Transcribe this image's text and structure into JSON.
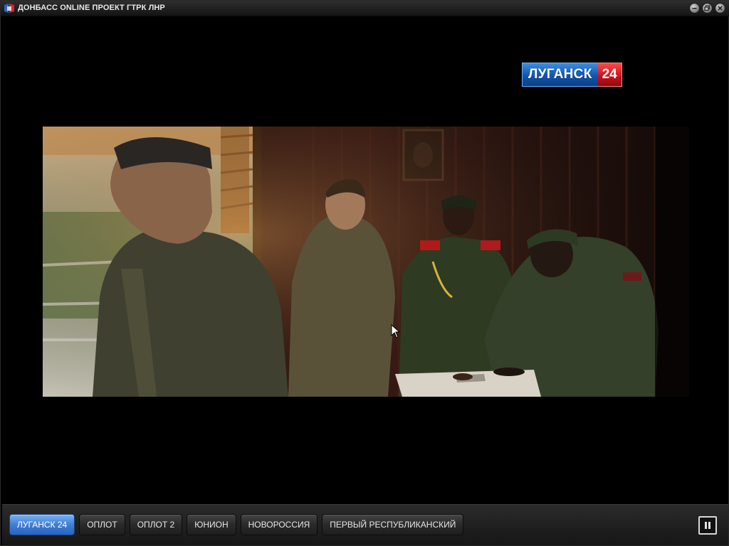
{
  "window": {
    "title": "ДОНБАСС ONLINE ПРОЕКТ ГТРК ЛНР",
    "icon": "app-logo-icon",
    "controls": [
      "minimize-icon",
      "restore-icon",
      "close-icon"
    ]
  },
  "video": {
    "channel_logo": {
      "name": "ЛУГАНСК",
      "number": "24"
    }
  },
  "toolbar": {
    "channels": [
      {
        "label": "ЛУГАНСК 24",
        "active": true
      },
      {
        "label": "ОПЛОТ",
        "active": false
      },
      {
        "label": "ОПЛОТ 2",
        "active": false
      },
      {
        "label": "ЮНИОН",
        "active": false
      },
      {
        "label": "НОВОРОССИЯ",
        "active": false
      },
      {
        "label": "ПЕРВЫЙ РЕСПУБЛИКАНСКИЙ",
        "active": false
      }
    ],
    "pause_icon": "pause-icon"
  },
  "colors": {
    "active_button": "#3f7fd6",
    "logo_blue": "#1155b0",
    "logo_red": "#c8101a"
  }
}
